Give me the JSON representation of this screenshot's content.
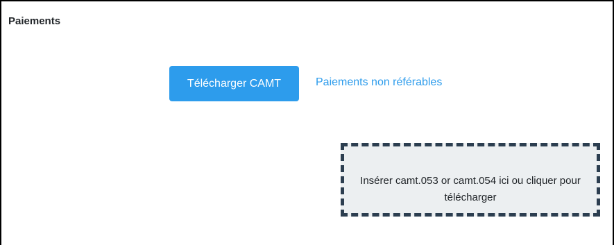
{
  "panel": {
    "title": "Paiements"
  },
  "actions": {
    "upload_button_label": "Télécharger CAMT",
    "unreferable_link_label": "Paiements non référables"
  },
  "dropzone": {
    "text": "Insérer camt.053 or camt.054 ici ou cliquer pour télécharger"
  },
  "colors": {
    "primary": "#2d9cec",
    "dropzone_border": "#2c3e50",
    "dropzone_background": "#eceff1"
  }
}
